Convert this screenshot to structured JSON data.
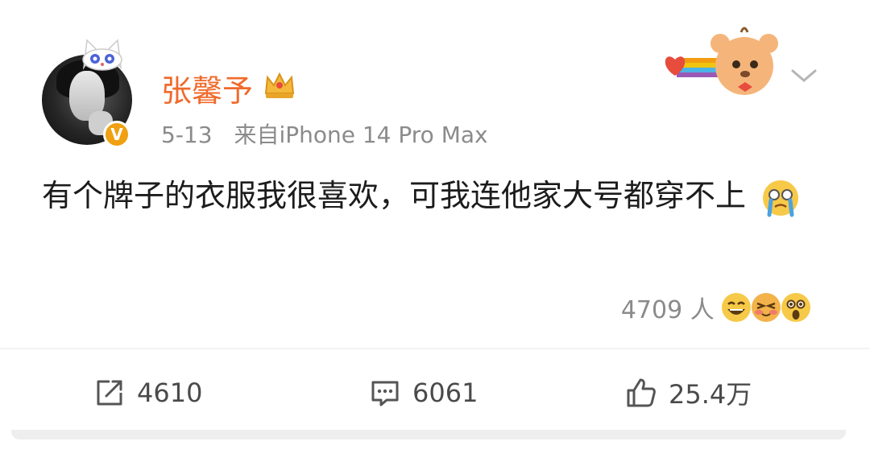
{
  "header": {
    "username": "张馨予",
    "date": "5-13",
    "source": "来自iPhone 14 Pro Max",
    "verified_mark": "V"
  },
  "post": {
    "text": "有个牌子的衣服我很喜欢，可我连他家大号都穿不上",
    "inline_emoji": "crying-emoji"
  },
  "reactions": {
    "count_label": "4709 人",
    "emojis": [
      "laughing-emoji",
      "blushing-emoji",
      "shocked-emoji"
    ]
  },
  "actions": {
    "repost_count": "4610",
    "comment_count": "6061",
    "like_count": "25.4万"
  },
  "colors": {
    "username": "#f06a2b",
    "meta_text": "#8b8b8b",
    "body_text": "#1c1c1c",
    "action_text": "#4a4a4a",
    "verified_badge": "#f0a010"
  }
}
